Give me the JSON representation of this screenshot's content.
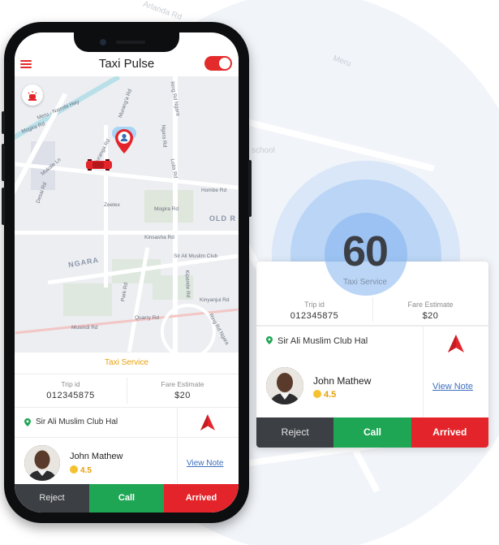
{
  "app": {
    "title": "Taxi Pulse"
  },
  "map": {
    "labels": [
      "Meru - Nairobi Hwy",
      "Murang'a Rd",
      "Ring Rd Ngara",
      "Hombe Rd",
      "Mogira Rd",
      "Zeetex",
      "OLD R",
      "Kinsasha Rd",
      "Sir Ali Muslim Club",
      "NGARA",
      "Quarry Rd",
      "Musindi Rd",
      "Kinyanjui Rd",
      "Park Rd",
      "Ring Rd Ngara",
      "Loita Rd",
      "Desai Rd",
      "Mukale Ln",
      "Muranga Rd",
      "Kipande Rd",
      "Ngara Rd",
      "Mogira Rd"
    ]
  },
  "card": {
    "service_label": "Taxi Service",
    "trip_id_label": "Trip id",
    "trip_id": "012345875",
    "fare_label": "Fare Estimate",
    "fare": "$20",
    "location": "Sir Ali Muslim Club Hal",
    "driver_name": "John Mathew",
    "rating": "4.5",
    "view_note": "View Note",
    "reject": "Reject",
    "call": "Call",
    "arrived": "Arrived"
  },
  "popup": {
    "countdown": "60",
    "service_label": "Taxi Service",
    "trip_id_label": "Trip id",
    "trip_id": "012345875",
    "fare_label": "Fare Estimate",
    "fare": "$20",
    "location": "Sir Ali Muslim Club Hal",
    "driver_name": "John Mathew",
    "rating": "4.5",
    "view_note": "View Note",
    "reject": "Reject",
    "call": "Call",
    "arrived": "Arrived"
  },
  "background_labels": [
    "Arlanda Rd",
    "Meru",
    "school"
  ],
  "colors": {
    "accent_red": "#e3252b",
    "call_green": "#1fa654",
    "reject_dark": "#3c3f44",
    "service_orange": "#e8a008",
    "link_blue": "#3d6fbf",
    "pulse_blue": "#bcd7f7"
  }
}
